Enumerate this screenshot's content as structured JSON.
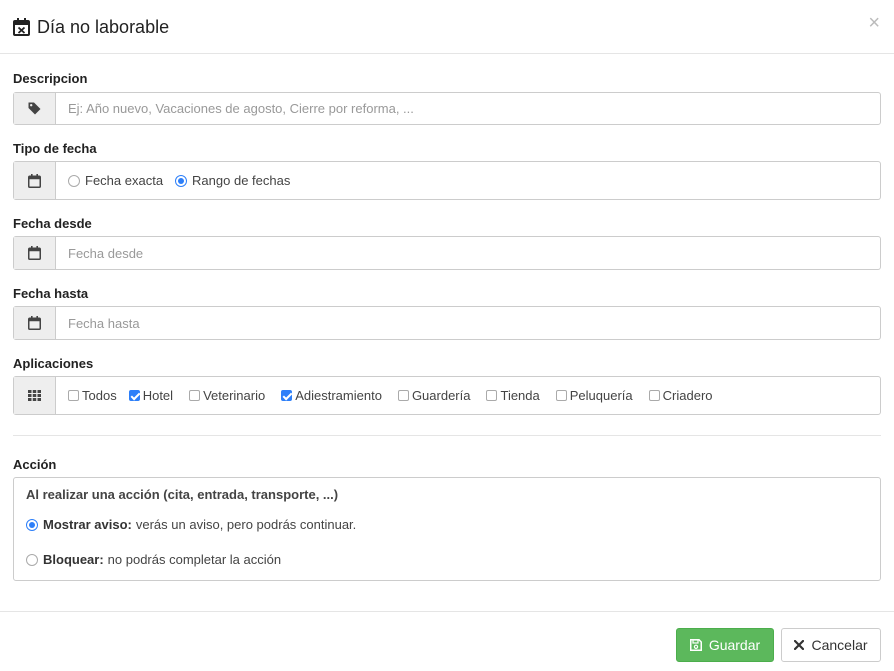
{
  "modal": {
    "title": "Día no laborable",
    "close_label": "×"
  },
  "descripcion": {
    "label": "Descripcion",
    "placeholder": "Ej: Año nuevo, Vacaciones de agosto, Cierre por reforma, ...",
    "value": ""
  },
  "tipo_fecha": {
    "label": "Tipo de fecha",
    "options": [
      {
        "label": "Fecha exacta",
        "selected": false
      },
      {
        "label": "Rango de fechas",
        "selected": true
      }
    ]
  },
  "fecha_desde": {
    "label": "Fecha desde",
    "placeholder": "Fecha desde",
    "value": ""
  },
  "fecha_hasta": {
    "label": "Fecha hasta",
    "placeholder": "Fecha hasta",
    "value": ""
  },
  "aplicaciones": {
    "label": "Aplicaciones",
    "items": [
      {
        "label": "Todos",
        "checked": false
      },
      {
        "label": "Hotel",
        "checked": true
      },
      {
        "label": "Veterinario",
        "checked": false
      },
      {
        "label": "Adiestramiento",
        "checked": true
      },
      {
        "label": "Guardería",
        "checked": false
      },
      {
        "label": "Tienda",
        "checked": false
      },
      {
        "label": "Peluquería",
        "checked": false
      },
      {
        "label": "Criadero",
        "checked": false
      }
    ]
  },
  "accion": {
    "label": "Acción",
    "title": "Al realizar una acción (cita, entrada, transporte, ...)",
    "options": [
      {
        "label": "Mostrar aviso:",
        "description": "verás un aviso, pero podrás continuar.",
        "selected": true
      },
      {
        "label": "Bloquear:",
        "description": "no podrás completar la acción",
        "selected": false
      }
    ]
  },
  "footer": {
    "save_label": "Guardar",
    "cancel_label": "Cancelar"
  },
  "colors": {
    "accent": "#2d7ff9",
    "save_button": "#5cb85c"
  }
}
